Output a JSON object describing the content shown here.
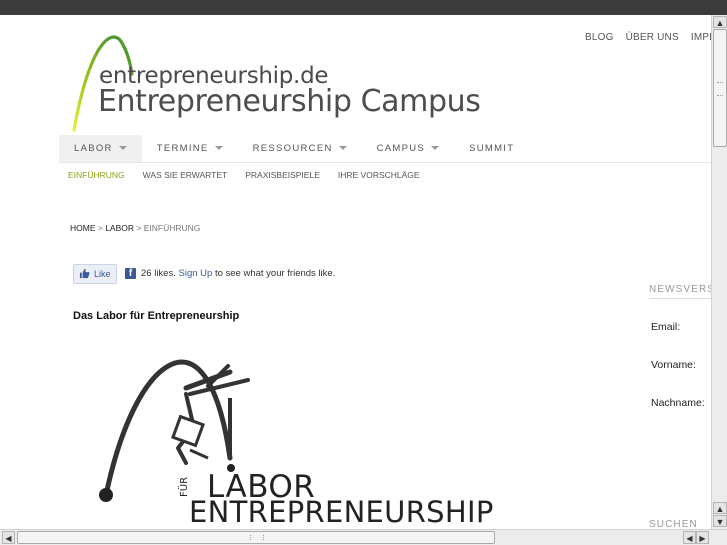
{
  "header": {
    "utility_links": [
      "BLOG",
      "ÜBER UNS",
      "IMPR"
    ],
    "logo_domain": "entrepreneurship.de",
    "logo_title": "Entrepreneurship Campus",
    "logo_arc_color": "#9ac31c"
  },
  "nav": {
    "items": [
      {
        "label": "LABOR"
      },
      {
        "label": "TERMINE"
      },
      {
        "label": "RESSOURCEN"
      },
      {
        "label": "CAMPUS"
      },
      {
        "label": "SUMMIT"
      }
    ],
    "sub_items": [
      "EINFÜHRUNG",
      "WAS SIE ERWARTET",
      "PRAXISBEISPIELE",
      "IHRE VORSCHLÄGE"
    ],
    "accent": "#8aa21a"
  },
  "breadcrumb": {
    "home": "HOME",
    "sep1": " > ",
    "labor": "LABOR",
    "sep2": " > ",
    "current": "EINFÜHRUNG"
  },
  "facebook": {
    "like_label": "Like",
    "count_text": "26 likes.",
    "signup_link": "Sign Up",
    "suffix_text": "to see what your friends like."
  },
  "content": {
    "title": "Das Labor für Entrepreneurship",
    "image_word_labor": "LABOR",
    "image_word_fuer": "FÜR",
    "image_word_entrepreneurship": "ENTREPRENEURSHIP"
  },
  "sidebar": {
    "newsletter_title": "NEWSVERS",
    "email_label": "Email:",
    "vorname_label": "Vorname:",
    "nachname_label": "Nachname:",
    "search_title": "SUCHEN"
  },
  "icons": {
    "up": "▲",
    "down": "▼",
    "left": "◀",
    "right": "▶"
  }
}
